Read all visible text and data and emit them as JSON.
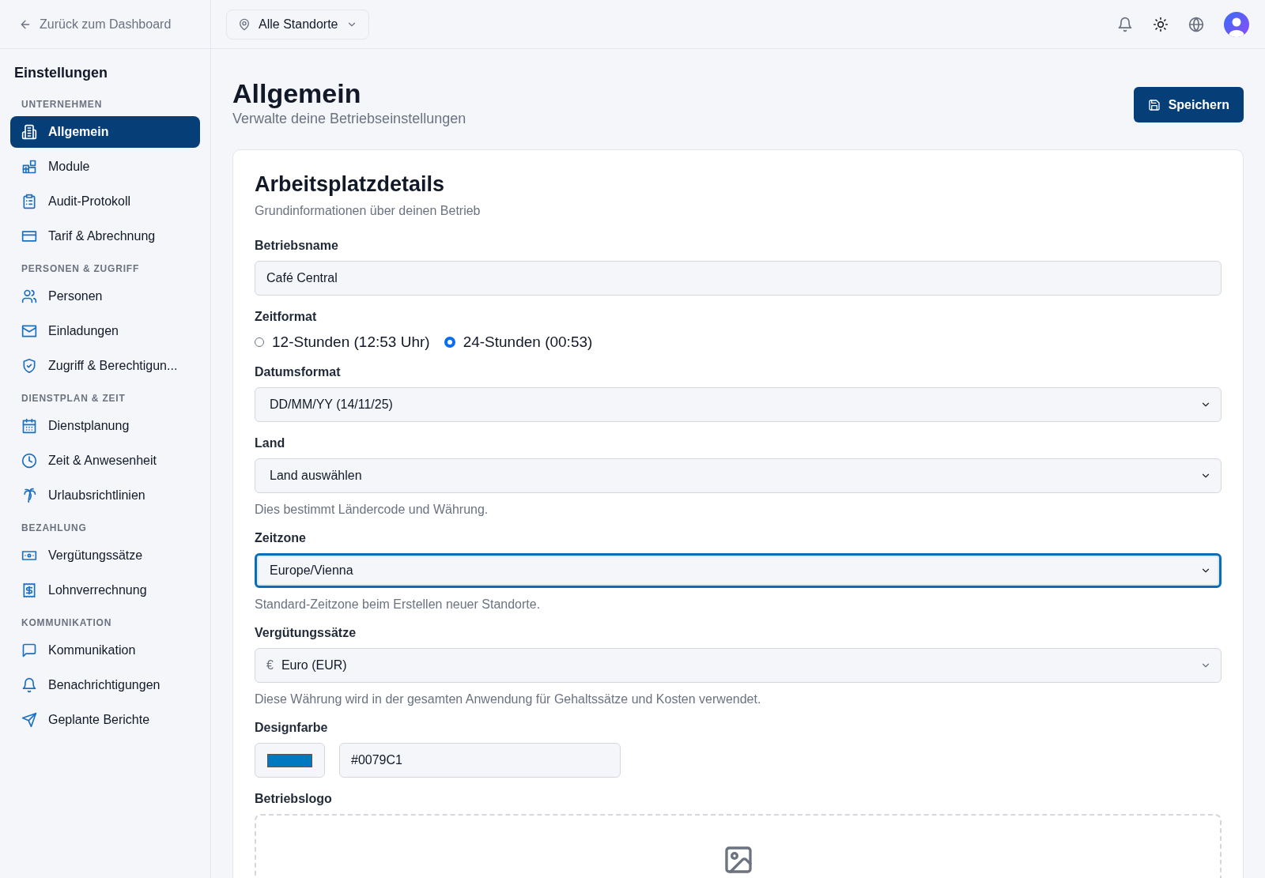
{
  "top_bar": {
    "back_link": "Zurück zum Dashboard",
    "location_selector": "Alle Standorte"
  },
  "sidebar": {
    "title": "Einstellungen",
    "sections": [
      {
        "heading": "UNTERNEHMEN",
        "items": [
          {
            "label": "Allgemein",
            "selected": true
          },
          {
            "label": "Module",
            "selected": false
          },
          {
            "label": "Audit-Protokoll",
            "selected": false
          },
          {
            "label": "Tarif & Abrechnung",
            "selected": false
          }
        ]
      },
      {
        "heading": "PERSONEN & ZUGRIFF",
        "items": [
          {
            "label": "Personen",
            "selected": false
          },
          {
            "label": "Einladungen",
            "selected": false
          },
          {
            "label": "Zugriff & Berechtigun...",
            "selected": false
          }
        ]
      },
      {
        "heading": "DIENSTPLAN & ZEIT",
        "items": [
          {
            "label": "Dienstplanung",
            "selected": false
          },
          {
            "label": "Zeit & Anwesenheit",
            "selected": false
          },
          {
            "label": "Urlaubsrichtlinien",
            "selected": false
          }
        ]
      },
      {
        "heading": "BEZAHLUNG",
        "items": [
          {
            "label": "Vergütungssätze",
            "selected": false
          },
          {
            "label": "Lohnverrechnung",
            "selected": false
          }
        ]
      },
      {
        "heading": "KOMMUNIKATION",
        "items": [
          {
            "label": "Kommunikation",
            "selected": false
          },
          {
            "label": "Benachrichtigungen",
            "selected": false
          },
          {
            "label": "Geplante Berichte",
            "selected": false
          }
        ]
      }
    ]
  },
  "page": {
    "title": "Allgemein",
    "subtitle": "Verwalte deine Betriebseinstellungen",
    "save_button": "Speichern"
  },
  "card": {
    "title": "Arbeitsplatzdetails",
    "subtitle": "Grundinformationen über deinen Betrieb",
    "fields": [
      {
        "kind": "text",
        "label": "Betriebsname",
        "value": "Café Central"
      },
      {
        "kind": "radio",
        "label": "Zeitformat",
        "options": [
          {
            "label": "12-Stunden (12:53 Uhr)",
            "selected": false
          },
          {
            "label": "24-Stunden (00:53)",
            "selected": true
          }
        ]
      },
      {
        "kind": "select",
        "label": "Datumsformat",
        "value": "DD/MM/YY (14/11/25)",
        "focused": false
      },
      {
        "kind": "select",
        "label": "Land",
        "value": "Land auswählen",
        "focused": false,
        "help": "Dies bestimmt Ländercode und Währung."
      },
      {
        "kind": "select",
        "label": "Zeitzone",
        "value": "Europe/Vienna",
        "focused": true,
        "help": "Standard-Zeitzone beim Erstellen neuer Standorte."
      },
      {
        "kind": "currency",
        "label": "Vergütungssätze",
        "symbol": "€",
        "value": "Euro (EUR)",
        "help": "Diese Währung wird in der gesamten Anwendung für Gehaltssätze und Kosten verwendet."
      },
      {
        "kind": "color",
        "label": "Designfarbe",
        "color": "#0079c1",
        "value": "#0079C1"
      },
      {
        "kind": "dropzone",
        "label": "Betriebslogo"
      }
    ]
  }
}
